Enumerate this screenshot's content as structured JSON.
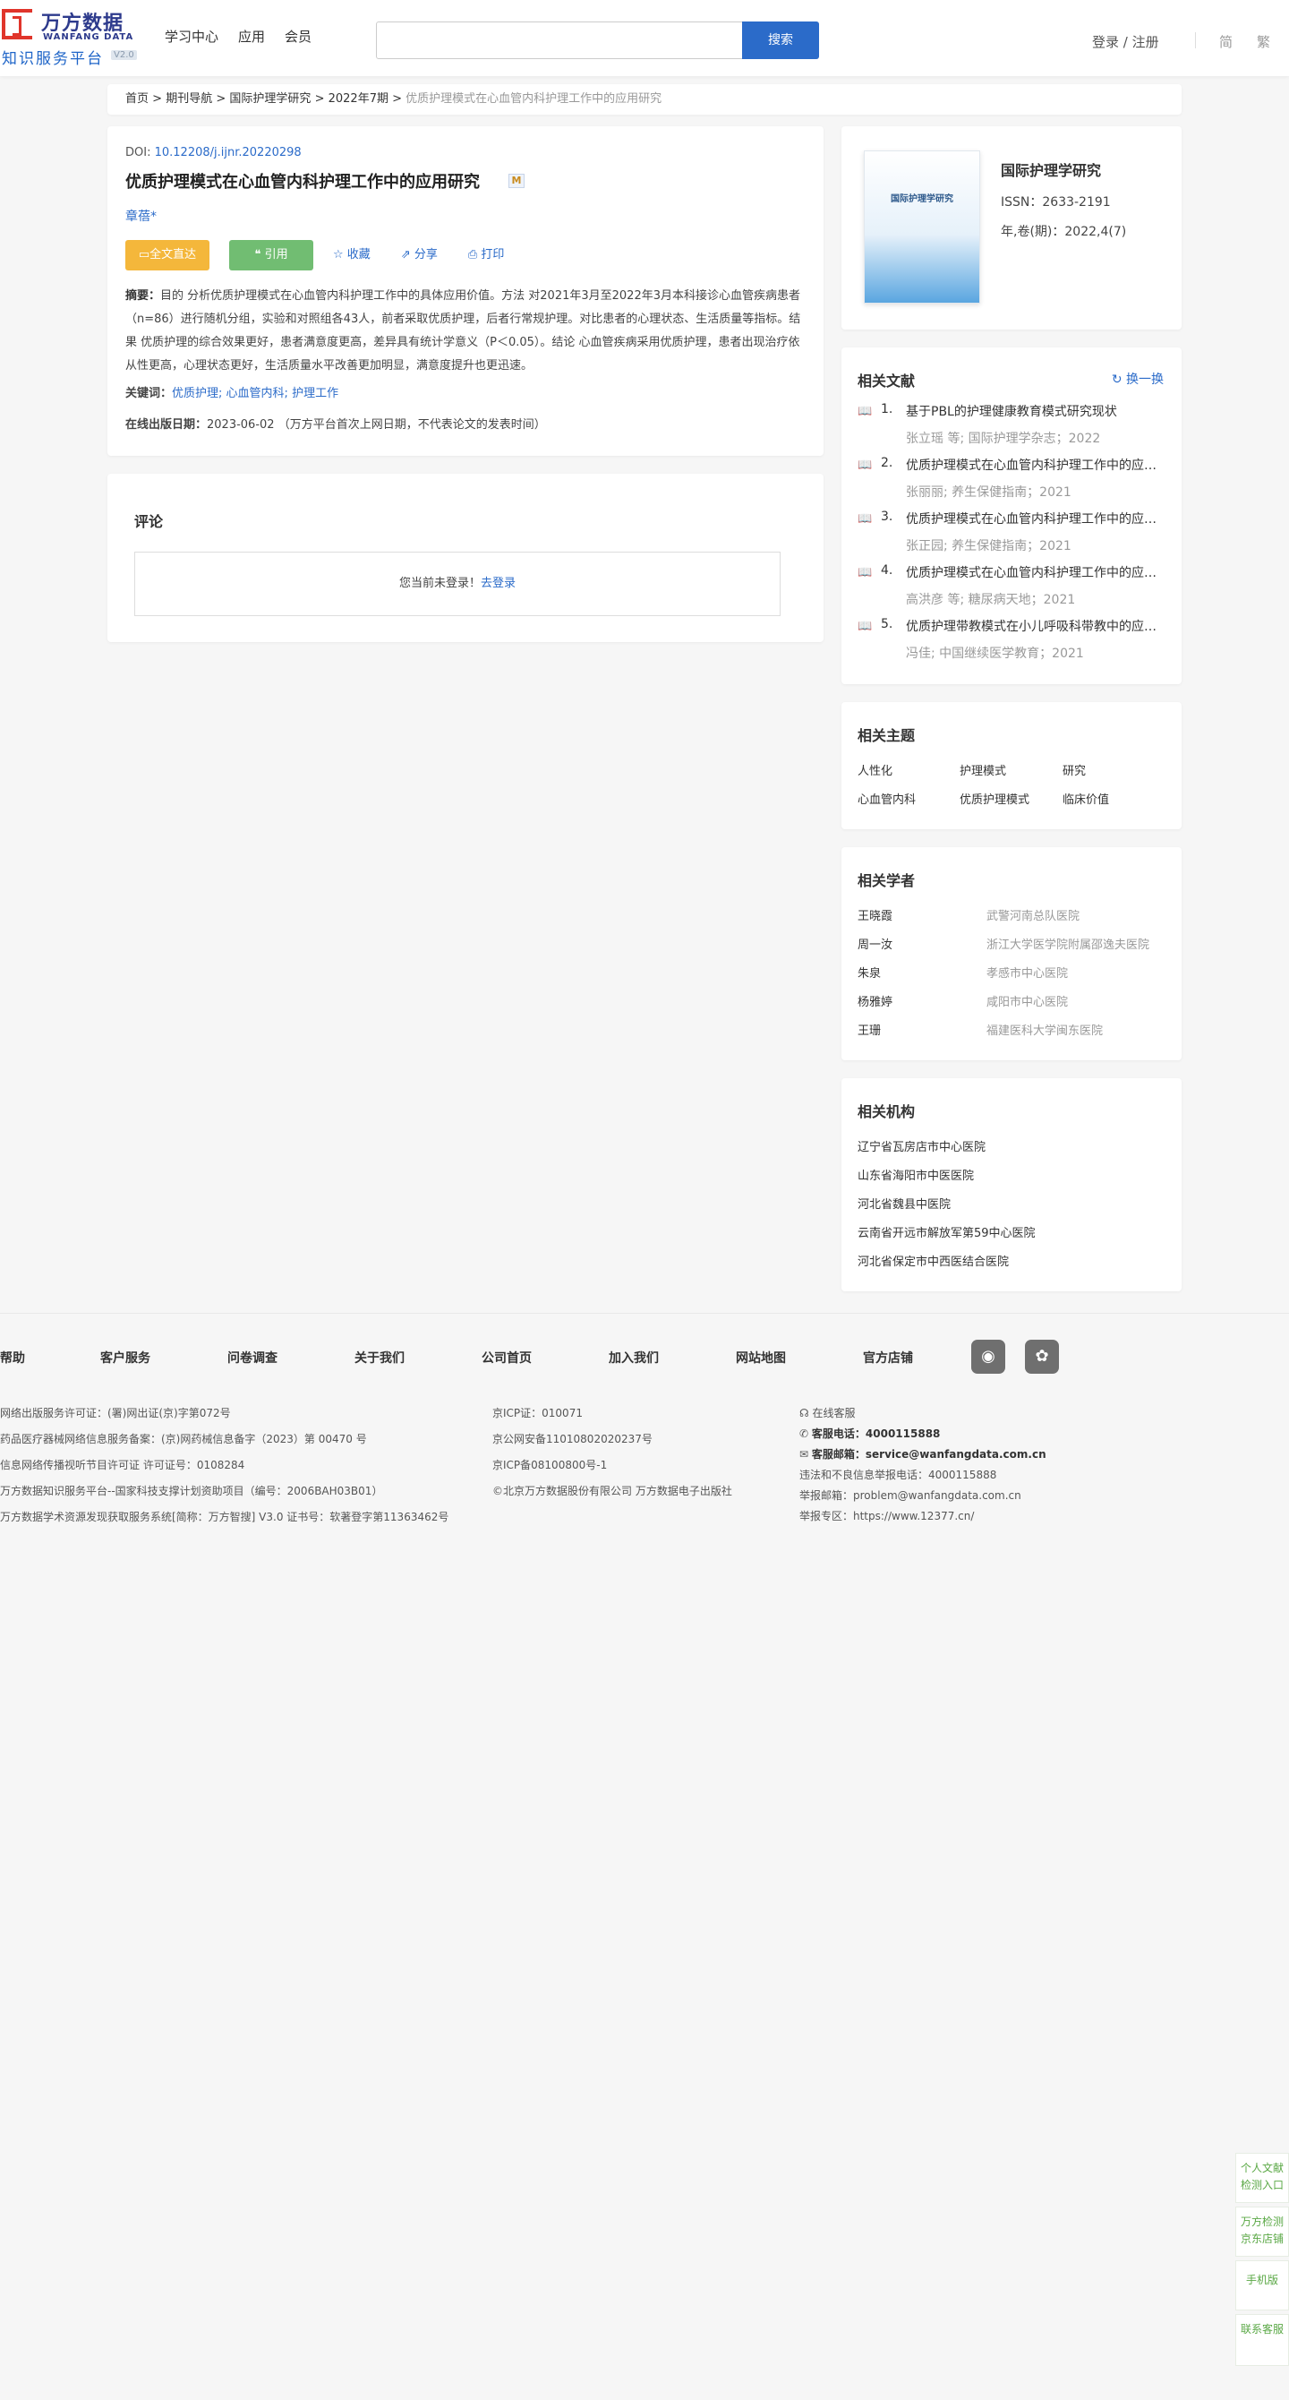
{
  "header": {
    "logo_cn": "万方数据",
    "logo_en": "WANFANG DATA",
    "logo_sub": "知识服务平台",
    "logo_ver": "V2.0",
    "nav": [
      "学习中心",
      "应用",
      "会员"
    ],
    "search_placeholder": "",
    "search_label": "搜索",
    "login_label": "登录 / 注册",
    "lang_simplified": "简",
    "lang_traditional": "繁"
  },
  "breadcrumb": {
    "items": [
      "首页",
      "期刊导航",
      "国际护理学研究",
      "2022年7期"
    ],
    "current": "优质护理模式在心血管内科护理工作中的应用研究",
    "sep": ">"
  },
  "article": {
    "doi_label": "DOI:",
    "doi": "10.12208/j.ijnr.20220298",
    "title": "优质护理模式在心血管内科护理工作中的应用研究",
    "badge": "M",
    "author": "章蓓*",
    "buttons": {
      "fulltext": "全文直达",
      "cite": "引用",
      "collect": "收藏",
      "share": "分享",
      "print": "打印"
    },
    "abstract_label": "摘要：",
    "abstract": "目的 分析优质护理模式在心血管内科护理工作中的具体应用价值。方法 对2021年3月至2022年3月本科接诊心血管疾病患者（n=86）进行随机分组，实验和对照组各43人，前者采取优质护理，后者行常规护理。对比患者的心理状态、生活质量等指标。结果 优质护理的综合效果更好，患者满意度更高，差异具有统计学意义（P＜0.05）。结论 心血管疾病采用优质护理，患者出现治疗依从性更高，心理状态更好，生活质量水平改善更加明显，满意度提升也更迅速。",
    "keywords_label": "关键词：",
    "keywords": [
      "优质护理;",
      "心血管内科;",
      "护理工作"
    ],
    "pubdate_label": "在线出版日期：",
    "pubdate": "2023-06-02",
    "pubdate_note": "（万方平台首次上网日期，不代表论文的发表时间）"
  },
  "comment": {
    "title": "评论",
    "notice": "您当前未登录！",
    "login_link": "去登录"
  },
  "journal": {
    "cover_title": "国际护理学研究",
    "name": "国际护理学研究",
    "issn": "ISSN：2633-2191",
    "volume": "年,卷(期)：2022,4(7)"
  },
  "related": {
    "title": "相关文献",
    "refresh": "换一换",
    "items": [
      {
        "num": "1.",
        "title": "基于PBL的护理健康教育模式研究现状",
        "author": "张立瑶  等;",
        "meta": "国际护理学杂志；2022"
      },
      {
        "num": "2.",
        "title": "优质护理模式在心血管内科护理工作中的应用研究",
        "author": "张丽丽;",
        "meta": "养生保健指南；2021"
      },
      {
        "num": "3.",
        "title": "优质护理模式在心血管内科护理工作中的应用研究",
        "author": "张正园;",
        "meta": "养生保健指南；2021"
      },
      {
        "num": "4.",
        "title": "优质护理模式在心血管内科护理工作中的应用研究",
        "author": "高洪彦  等;",
        "meta": "糖尿病天地；2021"
      },
      {
        "num": "5.",
        "title": "优质护理带教模式在小儿呼吸科带教中的应用研究",
        "author": "冯佳;",
        "meta": "中国继续医学教育；2021"
      }
    ]
  },
  "topics": {
    "title": "相关主题",
    "items": [
      "人性化",
      "护理模式",
      "研究",
      "心血管内科",
      "优质护理模式",
      "临床价值"
    ]
  },
  "scholars": {
    "title": "相关学者",
    "items": [
      {
        "name": "王晓霞",
        "org": "武警河南总队医院"
      },
      {
        "name": "周一汝",
        "org": "浙江大学医学院附属邵逸夫医院"
      },
      {
        "name": "朱泉",
        "org": "孝感市中心医院"
      },
      {
        "name": "杨雅婷",
        "org": "咸阳市中心医院"
      },
      {
        "name": "王珊",
        "org": "福建医科大学闽东医院"
      }
    ]
  },
  "orgs": {
    "title": "相关机构",
    "items": [
      "辽宁省瓦房店市中心医院",
      "山东省海阳市中医医院",
      "河北省魏县中医院",
      "云南省开远市解放军第59中心医院",
      "河北省保定市中西医结合医院"
    ]
  },
  "footer": {
    "nav": [
      "帮助",
      "客户服务",
      "问卷调查",
      "关于我们",
      "公司首页",
      "加入我们",
      "网站地图",
      "官方店铺"
    ],
    "col1": [
      "网络出版服务许可证：(署)网出证(京)字第072号",
      "药品医疗器械网络信息服务备案：(京)网药械信息备字（2023）第 00470 号",
      "信息网络传播视听节目许可证 许可证号：0108284",
      "万方数据知识服务平台--国家科技支撑计划资助项目（编号：2006BAH03B01）",
      "万方数据学术资源发现获取服务系统[简称：万方智搜] V3.0 证书号：软著登字第11363462号"
    ],
    "col2": [
      "京ICP证：010071",
      "京公网安备11010802020237号",
      "京ICP备08100800号-1",
      "©北京万方数据股份有限公司 万方数据电子出版社"
    ],
    "online_service": "在线客服",
    "phone_label": "客服电话：",
    "phone": "4000115888",
    "email_label": "客服邮箱：",
    "email": "service@wanfangdata.com.cn",
    "report_phone": "违法和不良信息举报电话：4000115888",
    "report_email": "举报邮箱：problem@wanfangdata.com.cn",
    "report_site": "举报专区：https://www.12377.cn/"
  },
  "side": {
    "check": "个人文献检测入口",
    "store": "万方检测京东店铺",
    "mobile": "手机版",
    "contact": "联系客服"
  },
  "colors": {
    "accent": "#2b6bc9",
    "fulltext": "#f4b73b",
    "cite": "#71bd72",
    "logo_red": "#e0352b"
  }
}
